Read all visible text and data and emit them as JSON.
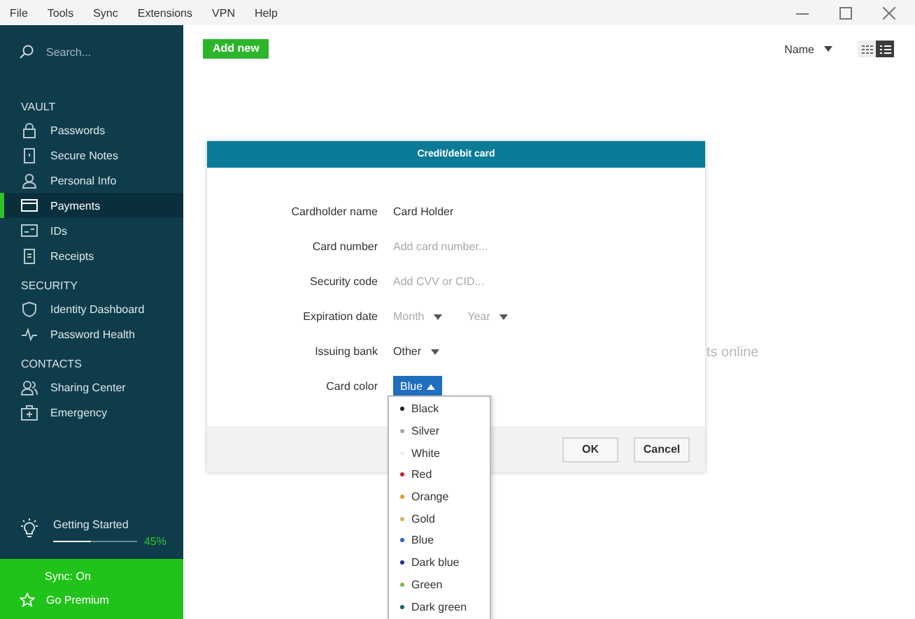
{
  "menu": [
    "File",
    "Tools",
    "Sync",
    "Extensions",
    "VPN",
    "Help"
  ],
  "sidebar": {
    "search": {
      "placeholder": "Search..."
    },
    "sections": [
      {
        "title": "VAULT",
        "items": [
          {
            "label": "Passwords",
            "selected": false
          },
          {
            "label": "Secure Notes",
            "selected": false
          },
          {
            "label": "Personal Info",
            "selected": false
          },
          {
            "label": "Payments",
            "selected": true
          },
          {
            "label": "IDs",
            "selected": false
          },
          {
            "label": "Receipts",
            "selected": false
          }
        ]
      },
      {
        "title": "SECURITY",
        "items": [
          {
            "label": "Identity Dashboard",
            "selected": false
          },
          {
            "label": "Password Health",
            "selected": false
          }
        ]
      },
      {
        "title": "CONTACTS",
        "items": [
          {
            "label": "Sharing Center",
            "selected": false
          },
          {
            "label": "Emergency",
            "selected": false
          }
        ]
      }
    ],
    "getting_started": {
      "label": "Getting Started",
      "level": 0.45,
      "percent": "45%"
    },
    "sync_status": "Sync: On",
    "premium": "Go Premium"
  },
  "toolbar": {
    "add_button": "Add new",
    "sort": "Name",
    "views": [
      {
        "selected": false
      },
      {
        "selected": true
      }
    ]
  },
  "background_text": "ts online",
  "dialog": {
    "title": "Credit/debit card",
    "fields": [
      {
        "label": "Cardholder name",
        "kind": "text",
        "value": "Card Holder"
      },
      {
        "label": "Card number",
        "kind": "text",
        "placeholder": "Add card number..."
      },
      {
        "label": "Security code",
        "kind": "text",
        "placeholder": "Add CVV or CID..."
      },
      {
        "label": "Expiration date",
        "kind": "selects",
        "selects": [
          {
            "placeholder": "Month"
          },
          {
            "placeholder": "Year"
          }
        ]
      },
      {
        "label": "Issuing bank",
        "kind": "selects",
        "selects": [
          {
            "value": "Other"
          }
        ]
      },
      {
        "label": "Card color",
        "kind": "color",
        "value": "Blue",
        "expanded": true,
        "options": [
          {
            "label": "Black",
            "color": "#222222"
          },
          {
            "label": "Silver",
            "color": "#aaaaaa"
          },
          {
            "label": "White",
            "color": "#eeeeee"
          },
          {
            "label": "Red",
            "color": "#c0262d"
          },
          {
            "label": "Orange",
            "color": "#e0a020"
          },
          {
            "label": "Gold",
            "color": "#d8b070"
          },
          {
            "label": "Blue",
            "color": "#2a6aa8"
          },
          {
            "label": "Dark blue",
            "color": "#1a2fa0"
          },
          {
            "label": "Green",
            "color": "#7cc040"
          },
          {
            "label": "Dark green",
            "color": "#1a6070"
          }
        ]
      }
    ],
    "buttons": [
      "OK",
      "Cancel"
    ]
  }
}
